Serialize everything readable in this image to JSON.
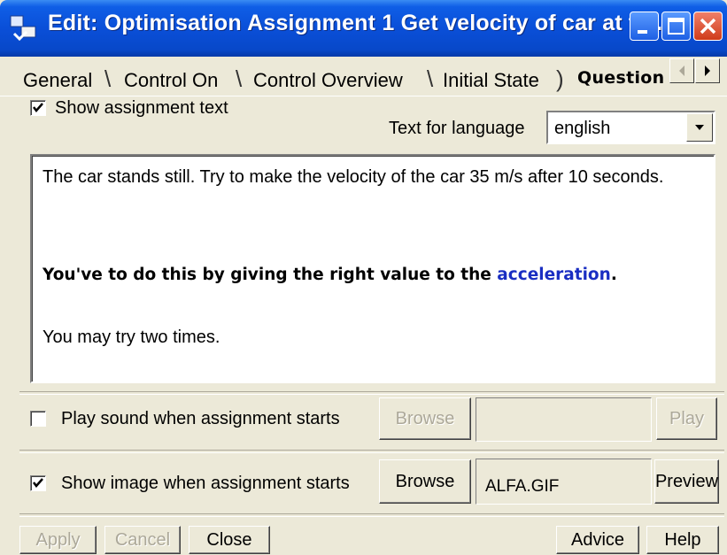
{
  "window": {
    "title": "Edit:  Optimisation Assignment 1  Get velocity of car at th..."
  },
  "tabs": [
    {
      "label": "General"
    },
    {
      "label": "Control On"
    },
    {
      "label": "Control Overview"
    },
    {
      "label": "Initial State"
    },
    {
      "label": "Question"
    }
  ],
  "show_text": {
    "label": "Show assignment text",
    "checked": true
  },
  "language": {
    "label": "Text for language",
    "value": "english"
  },
  "assignment_text": {
    "p1": "The car stands still. Try to make the velocity of the car 35 m/s after 10 seconds.",
    "p2_prefix": "You've to do this by giving the right value to the ",
    "p2_link": "acceleration",
    "p2_suffix": ".",
    "p3": "You may try two times."
  },
  "sound": {
    "label": "Play sound when assignment starts",
    "checked": false,
    "browse_label": "Browse",
    "file": "",
    "play_label": "Play"
  },
  "image": {
    "label": "Show image when assignment starts",
    "checked": true,
    "browse_label": "Browse",
    "file": "ALFA.GIF",
    "preview_label": "Preview"
  },
  "footer": {
    "apply_label": "Apply",
    "cancel_label": "Cancel",
    "close_label": "Close",
    "advice_label": "Advice",
    "help_label": "Help"
  },
  "colors": {
    "titlebar": "#0a4fd8",
    "link": "#1a2ec2",
    "face": "#ece9d8"
  }
}
